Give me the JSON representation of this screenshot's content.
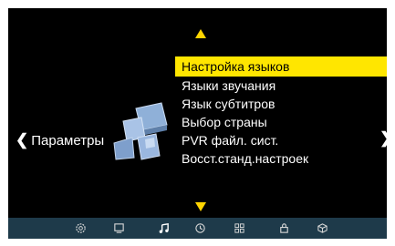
{
  "menu": {
    "items": [
      {
        "label": "Настройка языков",
        "selected": true
      },
      {
        "label": "Языки звучания",
        "selected": false
      },
      {
        "label": "Язык субтитров",
        "selected": false
      },
      {
        "label": "Выбор страны",
        "selected": false
      },
      {
        "label": "PVR файл. сист.",
        "selected": false
      },
      {
        "label": "Восст.станд.настроек",
        "selected": false
      }
    ]
  },
  "nav": {
    "left_chevron": "❮",
    "left_label": "Параметры",
    "right_chevron": "❯"
  },
  "bottom_bar": {
    "icons": [
      "settings-gear-icon",
      "picture-icon",
      "music-note-icon",
      "clock-icon",
      "grid-icon",
      "lock-icon",
      "cube-icon"
    ],
    "active": "music-note-icon"
  },
  "colors": {
    "highlight": "#ffe600",
    "arrow": "#ffd400",
    "bar": "#1e3a4a"
  }
}
